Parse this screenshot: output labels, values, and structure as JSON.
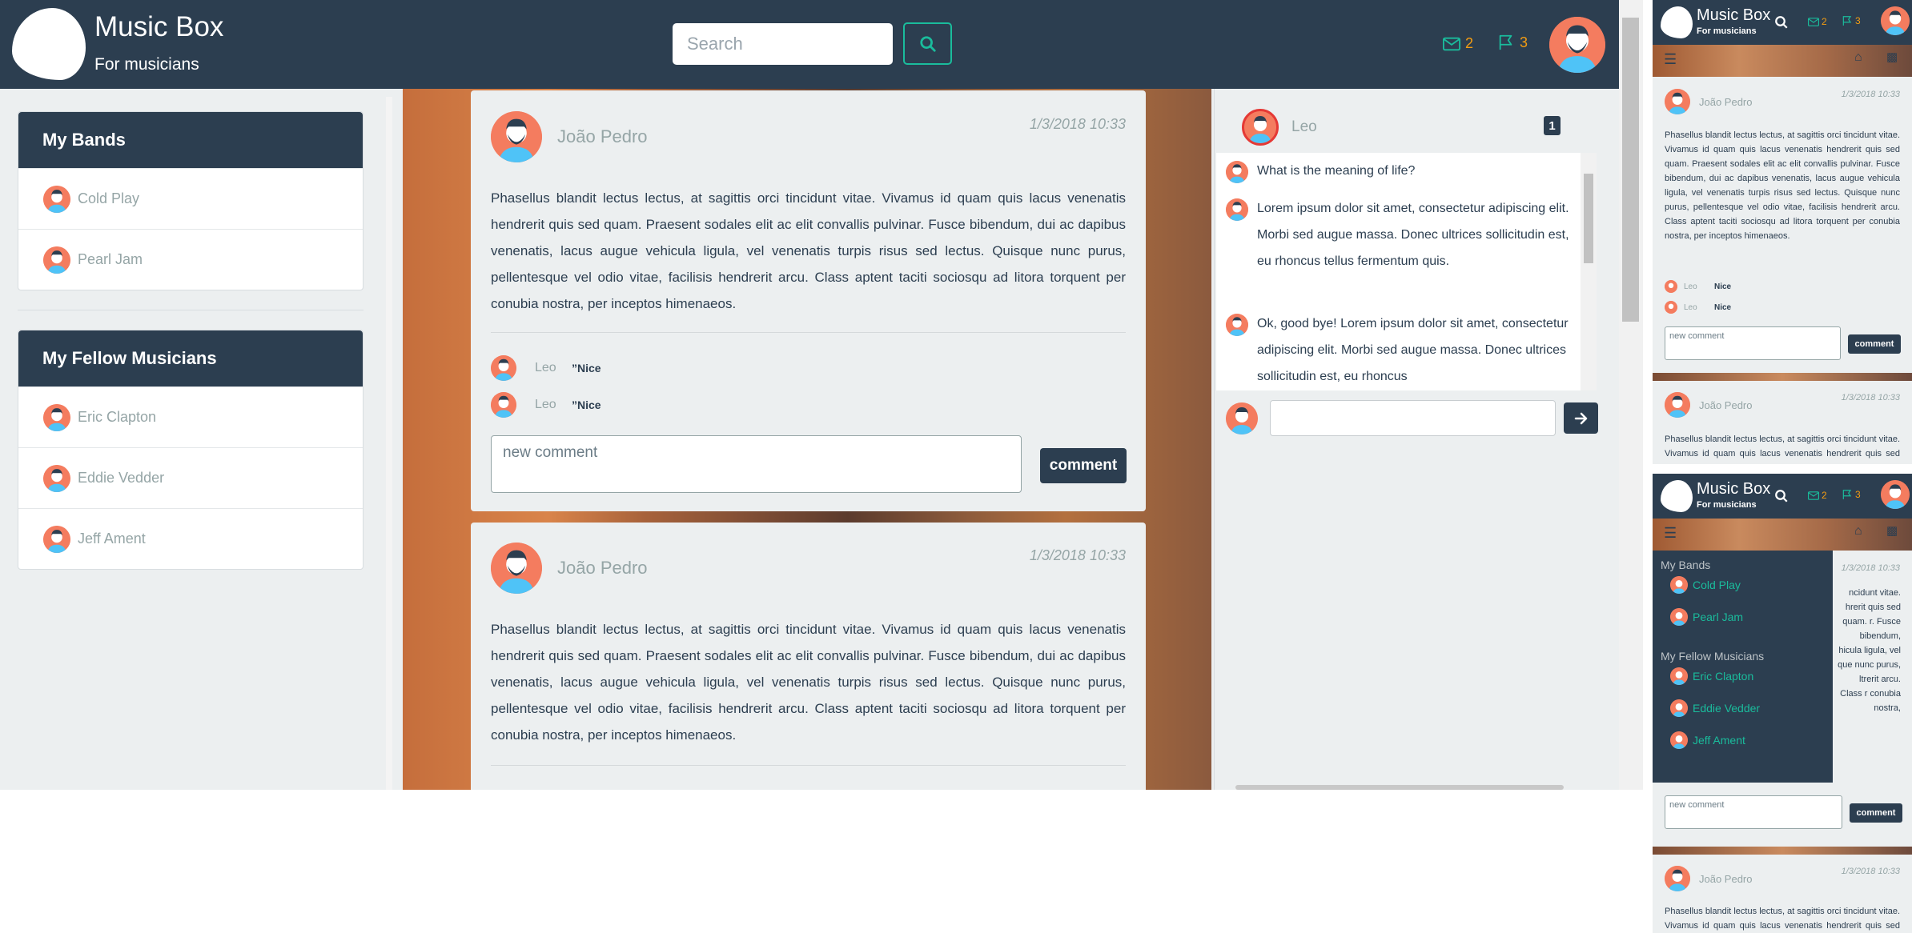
{
  "app": {
    "title": "Music Box",
    "subtitle": "For musicians"
  },
  "search": {
    "placeholder": "Search"
  },
  "header": {
    "messages_count": "2",
    "flags_count": "3"
  },
  "sidebar": {
    "bands": {
      "title": "My Bands",
      "items": [
        {
          "label": "Cold Play"
        },
        {
          "label": "Pearl Jam"
        }
      ]
    },
    "fellows": {
      "title": "My Fellow Musicians",
      "items": [
        {
          "label": "Eric Clapton"
        },
        {
          "label": "Eddie Vedder"
        },
        {
          "label": "Jeff Ament"
        }
      ]
    }
  },
  "posts": [
    {
      "author": "João Pedro",
      "date": "1/3/2018 10:33",
      "body": "Phasellus blandit lectus lectus, at sagittis orci tincidunt vitae. Vivamus id quam quis lacus venenatis hendrerit quis sed quam. Praesent sodales elit ac elit convallis pulvinar. Fusce bibendum, dui ac dapibus venenatis, lacus augue vehicula ligula, vel venenatis turpis risus sed lectus. Quisque nunc purus, pellentesque vel odio vitae, facilisis hendrerit arcu. Class aptent taciti sociosqu ad litora torquent per conubia nostra, per inceptos himenaeos.",
      "comments": [
        {
          "user": "Leo",
          "text": "Nice"
        },
        {
          "user": "Leo",
          "text": "Nice"
        }
      ],
      "comment_placeholder": "new comment",
      "comment_button": "comment"
    },
    {
      "author": "João Pedro",
      "date": "1/3/2018 10:33",
      "body": "Phasellus blandit lectus lectus, at sagittis orci tincidunt vitae. Vivamus id quam quis lacus venenatis hendrerit quis sed quam. Praesent sodales elit ac elit convallis pulvinar. Fusce bibendum, dui ac dapibus venenatis, lacus augue vehicula ligula, vel venenatis turpis risus sed lectus. Quisque nunc purus, pellentesque vel odio vitae, facilisis hendrerit arcu. Class aptent taciti sociosqu ad litora torquent per conubia nostra, per inceptos himenaeos."
    }
  ],
  "chat": {
    "contact": "Leo",
    "unread": "1",
    "messages": [
      {
        "text": "What is the meaning of life?"
      },
      {
        "text": "Lorem ipsum dolor sit amet, consectetur adipiscing elit. Morbi sed augue massa. Donec ultrices sollicitudin est, eu rhoncus tellus fermentum quis."
      },
      {
        "text": "Ok, good bye! Lorem ipsum dolor sit amet, consectetur adipiscing elit. Morbi sed augue massa. Donec ultrices sollicitudin est, eu rhoncus"
      }
    ]
  },
  "mobile": {
    "post_text_1": "Phasellus blandit lectus lectus, at sagittis orci tincidunt vitae. Vivamus id quam quis lacus venenatis hendrerit quis sed quam. Praesent sodales elit ac elit convallis pulvinar. Fusce bibendum, dui ac dapibus venenatis, lacus augue vehicula ligula, vel venenatis turpis risus sed lectus. Quisque nunc purus, pellentesque vel odio vitae, facilisis hendrerit arcu. Class aptent taciti sociosqu ad litora torquent per conubia nostra, per inceptos himenaeos.",
    "post_text_2": "Phasellus blandit lectus lectus, at sagittis orci tincidunt vitae. Vivamus id quam quis lacus venenatis hendrerit quis sed quam.",
    "post_text_3": "Phasellus blandit lectus lectus, at sagittis orci tincidunt vitae. Vivamus id quam quis lacus venenatis hendrerit quis sed quam.",
    "menu_partial_text": "ncidunt vitae. hrerit quis sed quam. r. Fusce bibendum, hicula ligula, vel que nunc purus, ltrerit arcu. Class r conubia nostra,"
  },
  "colors": {
    "navy": "#2c3e50",
    "teal": "#1abc9c",
    "orange": "#f39c12",
    "avatar": "#f47c5f"
  },
  "icons": [
    "logo-icon",
    "search-icon",
    "envelope-icon",
    "flag-icon",
    "user-avatar",
    "comment-quote-icon",
    "arrow-right-icon",
    "hamburger-icon",
    "home-icon",
    "chat-icon"
  ]
}
